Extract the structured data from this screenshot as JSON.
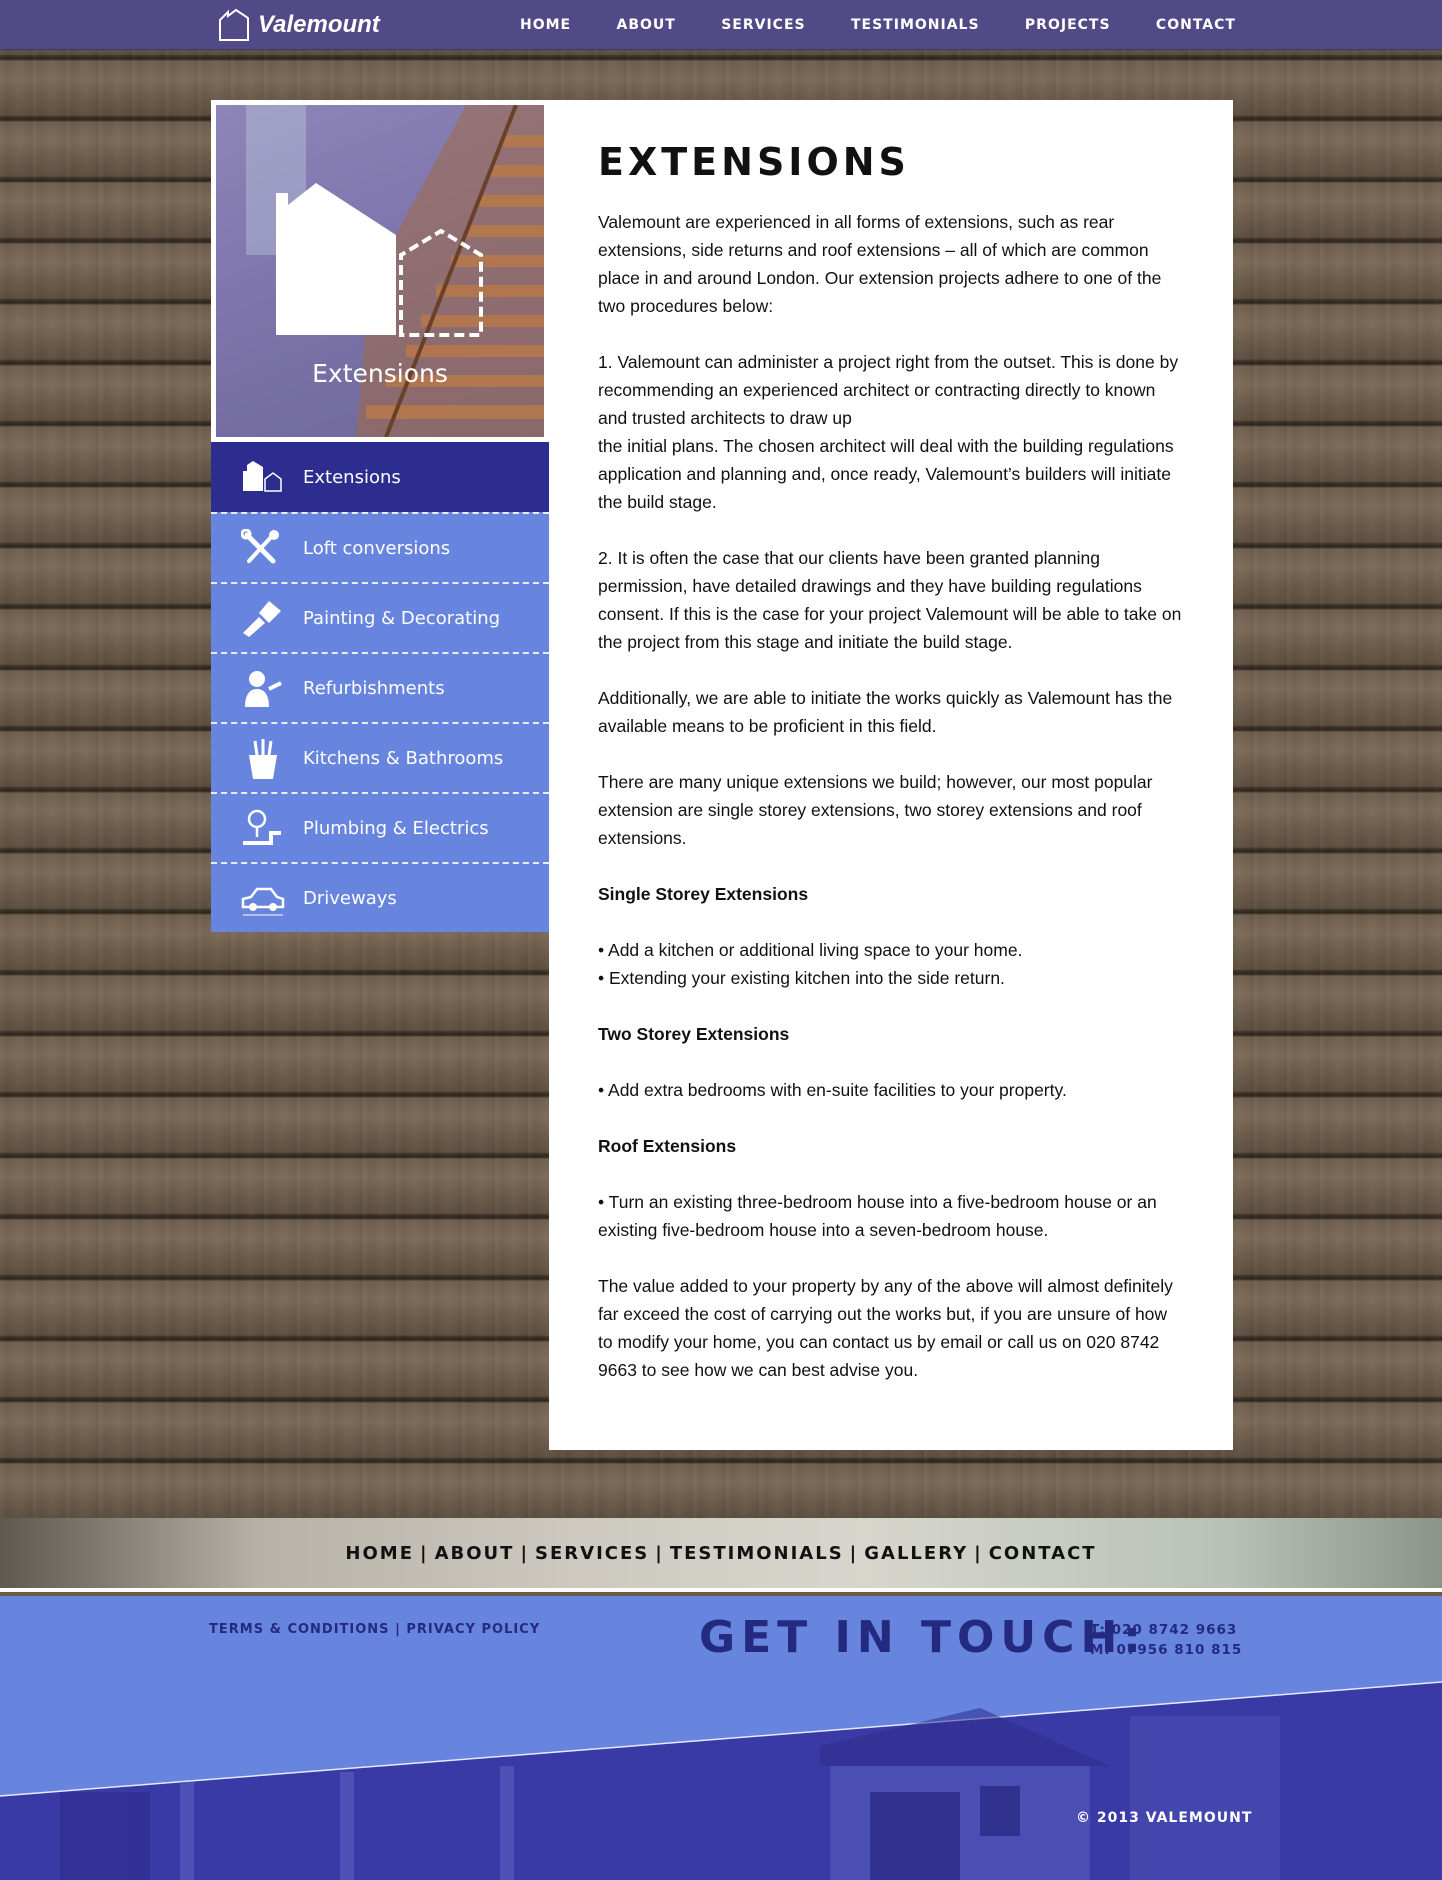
{
  "brand": {
    "name": "Valemount"
  },
  "nav": {
    "items": [
      "HOME",
      "ABOUT",
      "SERVICES",
      "TESTIMONIALS",
      "PROJECTS",
      "CONTACT"
    ]
  },
  "hero": {
    "caption": "Extensions"
  },
  "sidebar": {
    "items": [
      {
        "label": "Extensions",
        "icon": "house-icon",
        "active": true
      },
      {
        "label": "Loft conversions",
        "icon": "tools-icon"
      },
      {
        "label": "Painting & Decorating",
        "icon": "paintbrush-icon"
      },
      {
        "label": "Refurbishments",
        "icon": "worker-icon"
      },
      {
        "label": "Kitchens & Bathrooms",
        "icon": "utensils-icon"
      },
      {
        "label": "Plumbing & Electrics",
        "icon": "bulb-pipe-icon"
      },
      {
        "label": "Driveways",
        "icon": "car-icon"
      }
    ]
  },
  "content": {
    "title": "EXTENSIONS",
    "intro": "Valemount are experienced in all forms of extensions, such as rear extensions, side returns and roof extensions – all of which are common place in and around London. Our extension projects adhere to one of the two procedures below:",
    "p1a": "1. Valemount can administer a project right from the outset. This is done by recommending an experienced architect or contracting directly to known and trusted architects to draw up",
    "p1b": "the initial plans. The chosen architect will deal with the building regulations application and planning and, once ready, Valemount’s builders will initiate the build stage.",
    "p2": "2. It is often the case that our clients have been granted planning permission, have detailed drawings and they have building regulations consent. If this is the case for your project Valemount will be able to take on the project from this stage and initiate the build stage.",
    "p3": "Additionally, we are able to initiate the works quickly as Valemount has the available means to be proficient in this field.",
    "p4": "There are many unique extensions we build; however, our most popular extension are single storey extensions, two storey extensions and roof extensions.",
    "single_heading": "Single Storey Extensions",
    "single_b1": "• Add a kitchen or additional living space to your home.",
    "single_b2": "• Extending your existing kitchen into the side return.",
    "two_heading": "Two Storey Extensions",
    "two_b1": "• Add extra bedrooms with en-suite facilities to your property.",
    "roof_heading": "Roof Extensions",
    "roof_b1": "• Turn an existing three-bedroom house into a five-bedroom house or an existing five-bedroom house into a seven-bedroom house.",
    "closing": "The value added to your property by any of the above will almost definitely far exceed the cost of carrying out the works but, if you are unsure of how to modify your home, you can contact us by email or call us on 020 8742 9663 to see how we can best advise you."
  },
  "footer_nav": {
    "items": [
      "HOME",
      "ABOUT",
      "SERVICES",
      "TESTIMONIALS",
      "GALLERY",
      "CONTACT"
    ],
    "separator": "|"
  },
  "footer": {
    "terms": "TERMS & CONDITIONS",
    "privacy": "PRIVACY POLICY",
    "legal_sep": "|",
    "get_in_touch": "GET IN TOUCH:",
    "phone_t": "T: 020 8742 9663",
    "phone_m": "M: 07956 810 815",
    "copyright": "© 2013 VALEMOUNT"
  },
  "colors": {
    "topbar": "#514a86",
    "sidebar": "#6785de",
    "sidebar_active": "#2d2d90",
    "footer_text": "#232a80"
  }
}
